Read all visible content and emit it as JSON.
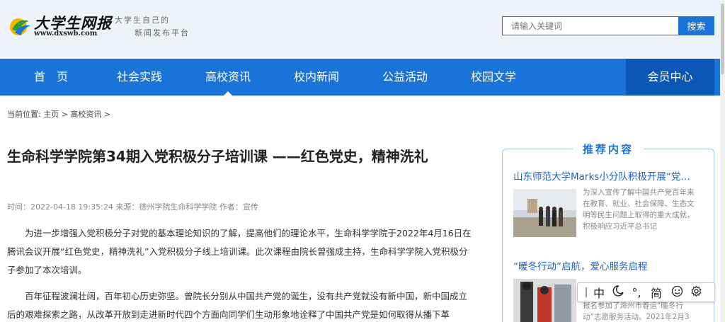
{
  "header": {
    "logo_title": "大学生网报",
    "logo_url": "www.dxswb.com",
    "slogan_line1": "大学生自己的",
    "slogan_line2": "新闻发布平台",
    "search_placeholder": "请输入关键词",
    "search_button": "搜索"
  },
  "nav": {
    "items": [
      {
        "label": "首　页"
      },
      {
        "label": "社会实践"
      },
      {
        "label": "高校资讯"
      },
      {
        "label": "校内新闻"
      },
      {
        "label": "公益活动"
      },
      {
        "label": "校园文学"
      }
    ],
    "active": "高校资讯",
    "member_center": "会员中心"
  },
  "breadcrumb": "当前位置: 主页 > 高校资讯 >",
  "article": {
    "title": "生命科学学院第34期入党积极分子培训课 ——红色党史，精神洗礼",
    "meta": "时间：2022-04-18 19:35:24 来源：德州学院生命科学学院 作者：宣传",
    "paragraphs": [
      "为进一步增强入党积极分子对党的基本理论知识的了解，提高他们的理论水平，生命科学学院于2022年4月16日在腾讯会议开展“红色党史，精神洗礼”入党积极分子线上培训课。此次课程由院长曾强成主持，生命科学学院入党积极分子参加了本次培训。",
      "百年征程波澜壮阔，百年初心历史弥坚。曾院长分别从中国共产党的诞生，没有共产党就没有新中国，新中国成立后的艰难探索之路，从改革开放到走进新时代四个方面向同学们生动形象地诠释了中国共产党是如何取得从播下革"
    ]
  },
  "recommend": {
    "heading": "推荐内容",
    "items": [
      {
        "title": "山东师范大学Marks小分队积极开展“党…",
        "summary": "为深入宣传了解中国共产党百年来在教育、就业、社会保障、生态文明等民生问题上取得的重大成就，积极响应习近平总书记"
      },
      {
        "title": "“暖冬行动”启航，爱心服务启程",
        "summary_visible": "报名参加了滁州市春运“暖冬行动”志愿服务活动。2021年2月3"
      }
    ]
  },
  "ime": {
    "mode": "中",
    "punct": "°,",
    "charset": "简"
  },
  "colors": {
    "primary": "#1a73d9",
    "nav_member_bg": "#0b57b5",
    "header_bg": "#eef3fa"
  }
}
